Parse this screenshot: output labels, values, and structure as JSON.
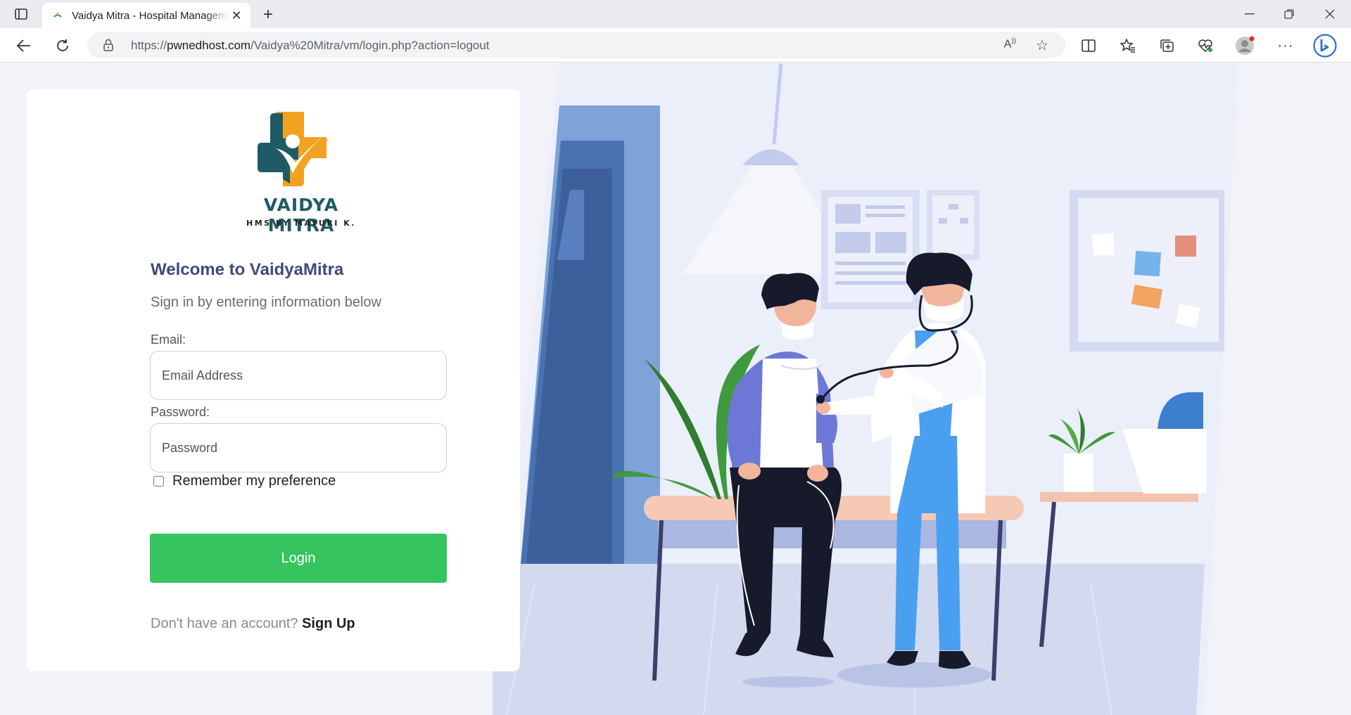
{
  "browser": {
    "tab_title": "Vaidya Mitra - Hospital Management System",
    "url_prefix": "https://",
    "url_host": "pwnedhost.com",
    "url_path": "/Vaidya%20Mitra/vm/login.php?action=logout",
    "icons": [
      "tab-actions-icon",
      "favicon-icon",
      "close-icon",
      "plus-icon",
      "minimize-icon",
      "restore-icon",
      "close-window-icon",
      "back-icon",
      "refresh-icon",
      "lock-icon",
      "read-aloud-icon",
      "star-icon",
      "split-screen-icon",
      "favorites-icon",
      "collections-icon",
      "health-icon",
      "profile-icon",
      "more-icon",
      "copilot-icon"
    ]
  },
  "login": {
    "brand": "VAIDYA MITRA",
    "brand_sub": "HMS BY MAYURI K.",
    "welcome": "Welcome to VaidyaMitra",
    "subtitle": "Sign in by entering information below",
    "email_label": "Email:",
    "email_placeholder": "Email Address",
    "password_label": "Password:",
    "password_placeholder": "Password",
    "remember_label": "Remember my preference",
    "login_button": "Login",
    "no_account_text": "Don't have an account?",
    "signup_link": "Sign Up"
  },
  "colors": {
    "logo_teal": "#1f5b67",
    "logo_orange": "#f2a21e",
    "welcome_text": "#3f4a7a",
    "login_button": "#35c45e"
  }
}
